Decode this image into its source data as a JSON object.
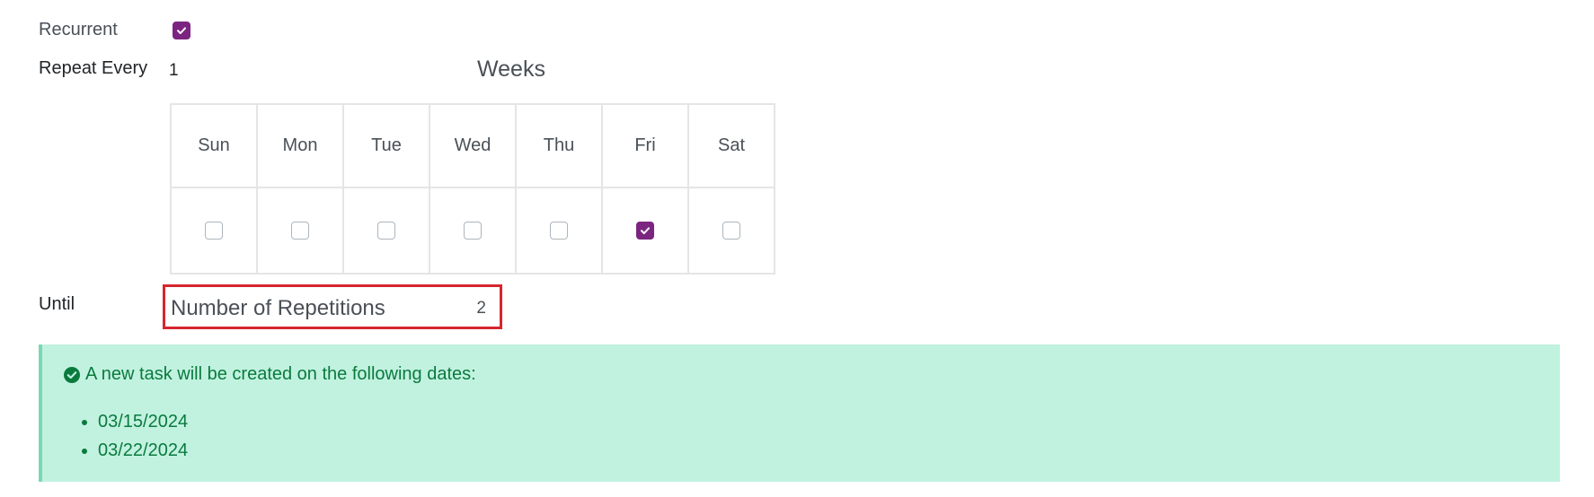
{
  "recurrent": {
    "label": "Recurrent",
    "checked": true
  },
  "repeat": {
    "label": "Repeat Every",
    "interval": "1",
    "unit": "Weeks"
  },
  "days": [
    {
      "label": "Sun",
      "checked": false
    },
    {
      "label": "Mon",
      "checked": false
    },
    {
      "label": "Tue",
      "checked": false
    },
    {
      "label": "Wed",
      "checked": false
    },
    {
      "label": "Thu",
      "checked": false
    },
    {
      "label": "Fri",
      "checked": true
    },
    {
      "label": "Sat",
      "checked": false
    }
  ],
  "until": {
    "label": "Until",
    "type": "Number of Repetitions",
    "count": "2",
    "highlight_color": "#d6262e"
  },
  "alert": {
    "message": "A new task will be created on the following dates:",
    "dates": [
      "03/15/2024",
      "03/22/2024"
    ],
    "icon": "check-circle-icon"
  },
  "colors": {
    "accent": "#7b2580",
    "alert_bg": "#c1f2e0",
    "alert_text": "#0a7a3d"
  }
}
